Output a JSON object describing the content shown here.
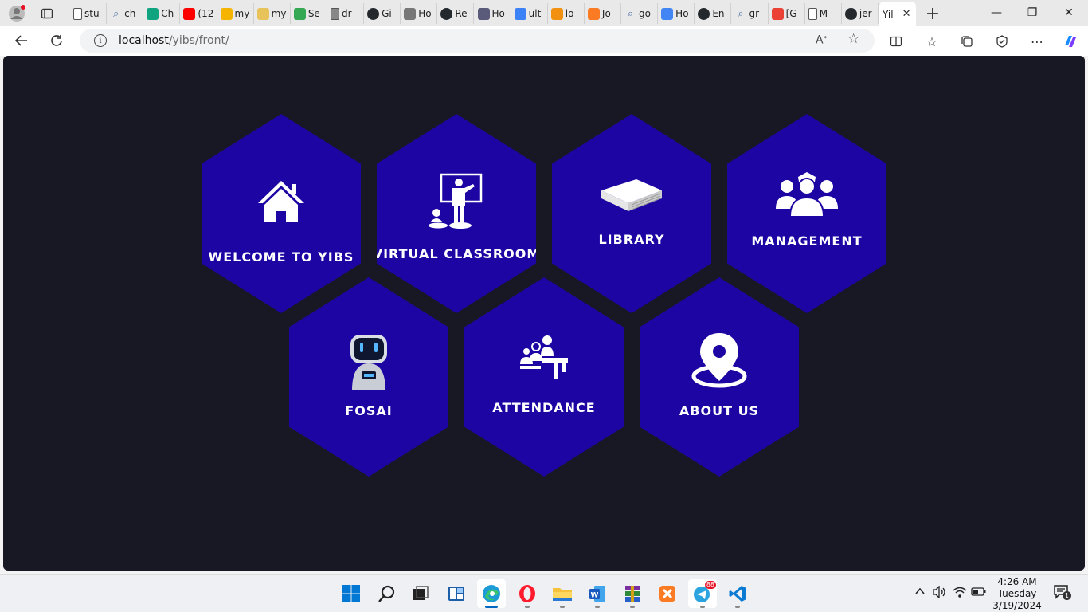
{
  "browser": {
    "tabs": [
      {
        "label": "stu",
        "icon": "page-icon",
        "color": "#ffffff"
      },
      {
        "label": "ch",
        "icon": "search-icon",
        "color": "#ffffff"
      },
      {
        "label": "Ch",
        "icon": "chatgpt-icon",
        "color": "#10a37f"
      },
      {
        "label": "(12",
        "icon": "youtube-icon",
        "color": "#ff0000"
      },
      {
        "label": "my",
        "icon": "drive-icon",
        "color": "#f4b400"
      },
      {
        "label": "my",
        "icon": "folder-icon",
        "color": "#e8c35a"
      },
      {
        "label": "Se",
        "icon": "drive-icon",
        "color": "#34a853"
      },
      {
        "label": "dr",
        "icon": "page-icon",
        "color": "#888888"
      },
      {
        "label": "Gi",
        "icon": "github-icon",
        "color": "#24292e"
      },
      {
        "label": "Ho",
        "icon": "app-icon",
        "color": "#777777"
      },
      {
        "label": "Re",
        "icon": "github-icon",
        "color": "#24292e"
      },
      {
        "label": "Ho",
        "icon": "app-icon",
        "color": "#5a5a7a"
      },
      {
        "label": "ult",
        "icon": "app-icon",
        "color": "#3b82f6"
      },
      {
        "label": "lo",
        "icon": "phpmyadmin-icon",
        "color": "#f29111"
      },
      {
        "label": "Jo",
        "icon": "xampp-icon",
        "color": "#fb7a24"
      },
      {
        "label": "go",
        "icon": "search-icon",
        "color": "#ffffff"
      },
      {
        "label": "Ho",
        "icon": "drive-icon",
        "color": "#4285f4"
      },
      {
        "label": "En",
        "icon": "github-icon",
        "color": "#24292e"
      },
      {
        "label": "gr",
        "icon": "search-icon",
        "color": "#ffffff"
      },
      {
        "label": "[G",
        "icon": "gmail-icon",
        "color": "#ea4335"
      },
      {
        "label": "M",
        "icon": "page-icon",
        "color": "#ffffff"
      },
      {
        "label": "jer",
        "icon": "github-icon",
        "color": "#24292e"
      }
    ],
    "active_tab": {
      "label": "Yil",
      "close": "✕"
    },
    "new_tab": "+",
    "address": {
      "host": "localhost",
      "path": "/yibs/front/"
    },
    "window_controls": [
      "—",
      "❐",
      "✕"
    ]
  },
  "page": {
    "tiles": [
      {
        "label": "WELCOME TO YIBS",
        "icon": "home-icon"
      },
      {
        "label": "VIRTUAL CLASSROOM",
        "icon": "teacher-icon"
      },
      {
        "label": "LIBRARY",
        "icon": "book-icon"
      },
      {
        "label": "MANAGEMENT",
        "icon": "group-icon"
      },
      {
        "label": "FOSAI",
        "icon": "robot-icon"
      },
      {
        "label": "ATTENDANCE",
        "icon": "attendance-icon"
      },
      {
        "label": "ABOUT US",
        "icon": "location-pin-icon"
      }
    ],
    "colors": {
      "background": "#181824",
      "tile": "#1d05a3",
      "text": "#ffffff"
    }
  },
  "taskbar": {
    "apps": [
      {
        "name": "start",
        "icon": "windows-icon"
      },
      {
        "name": "search",
        "icon": "search-icon"
      },
      {
        "name": "task-view",
        "icon": "task-view-icon"
      },
      {
        "name": "widgets",
        "icon": "widgets-icon"
      },
      {
        "name": "edge",
        "icon": "edge-icon"
      },
      {
        "name": "opera",
        "icon": "opera-icon"
      },
      {
        "name": "file-explorer",
        "icon": "folder-icon"
      },
      {
        "name": "word",
        "icon": "word-icon"
      },
      {
        "name": "winrar",
        "icon": "winrar-icon"
      },
      {
        "name": "xampp",
        "icon": "xampp-icon"
      },
      {
        "name": "telegram",
        "icon": "telegram-icon"
      },
      {
        "name": "vscode",
        "icon": "vscode-icon"
      }
    ],
    "telegram_badge": "88",
    "clock": {
      "time": "4:26 AM",
      "day": "Tuesday",
      "date": "3/19/2024"
    },
    "notification_count": "1"
  }
}
